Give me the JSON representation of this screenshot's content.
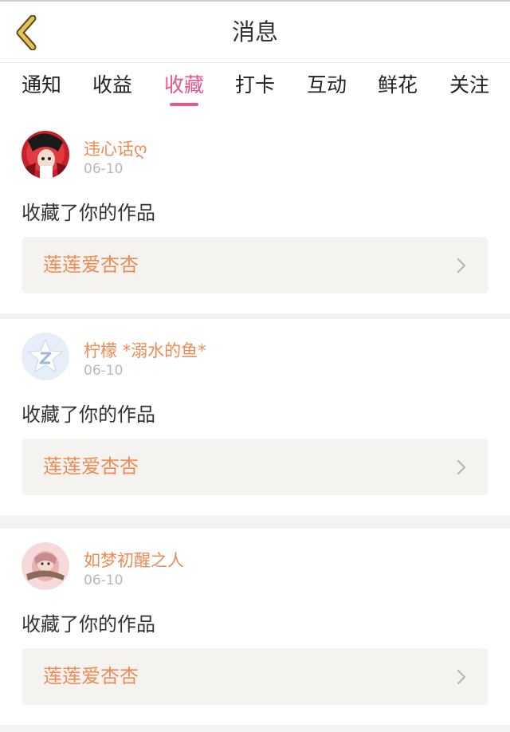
{
  "header": {
    "title": "消息",
    "back_icon": "chevron-left-icon"
  },
  "colors": {
    "accent": "#e8558f",
    "username": "#ef8a54",
    "back_icon": "#e4c15c"
  },
  "tabs": [
    {
      "label": "通知",
      "active": false
    },
    {
      "label": "收益",
      "active": false
    },
    {
      "label": "收藏",
      "active": true
    },
    {
      "label": "打卡",
      "active": false
    },
    {
      "label": "互动",
      "active": false
    },
    {
      "label": "鲜花",
      "active": false
    },
    {
      "label": "关注",
      "active": false
    }
  ],
  "messages": [
    {
      "username": "违心话ღ",
      "date": "06-10",
      "action": "收藏了你的作品",
      "work_title": "莲莲爱杏杏",
      "avatar": "anime-avatar-red"
    },
    {
      "username": "柠檬 *溺水的鱼*",
      "date": "06-10",
      "action": "收藏了你的作品",
      "work_title": "莲莲爱杏杏",
      "avatar": "default-star-avatar"
    },
    {
      "username": "如梦初醒之人",
      "date": "06-10",
      "action": "收藏了你的作品",
      "work_title": "莲莲爱杏杏",
      "avatar": "pink-illustration-avatar"
    }
  ]
}
